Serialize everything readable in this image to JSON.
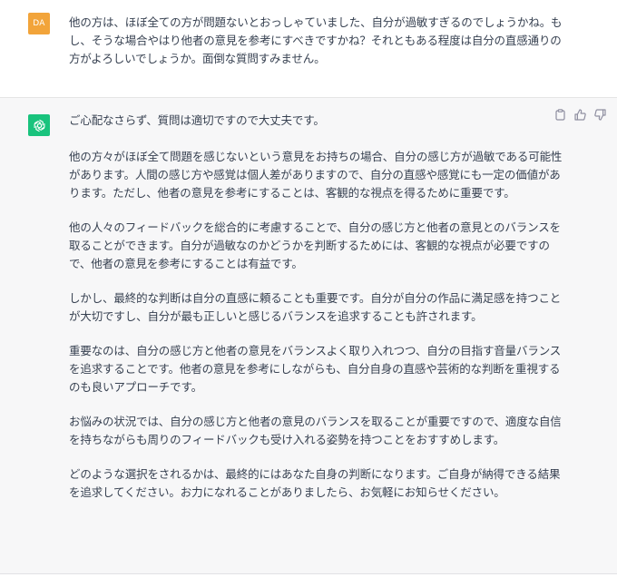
{
  "user_message": {
    "avatar_initials": "DA",
    "text": "他の方は、ほぼ全ての方が問題ないとおっしゃていました、自分が過敏すぎるのでしょうかね。もし、そうな場合やはり他者の意見を参考にすべきですかね？それともある程度は自分の直感通りの方がよろしいでしょうか。面倒な質問すみません。"
  },
  "assistant_message": {
    "paragraphs": [
      "ご心配なさらず、質問は適切ですので大丈夫です。",
      "他の方々がほぼ全て問題を感じないという意見をお持ちの場合、自分の感じ方が過敏である可能性があります。人間の感じ方や感覚は個人差がありますので、自分の直感や感覚にも一定の価値があります。ただし、他者の意見を参考にすることは、客観的な視点を得るために重要です。",
      "他の人々のフィードバックを総合的に考慮することで、自分の感じ方と他者の意見とのバランスを取ることができます。自分が過敏なのかどうかを判断するためには、客観的な視点が必要ですので、他者の意見を参考にすることは有益です。",
      "しかし、最終的な判断は自分の直感に頼ることも重要です。自分が自分の作品に満足感を持つことが大切ですし、自分が最も正しいと感じるバランスを追求することも許されます。",
      "重要なのは、自分の感じ方と他者の意見をバランスよく取り入れつつ、自分の目指す音量バランスを追求することです。他者の意見を参考にしながらも、自分自身の直感や芸術的な判断を重視するのも良いアプローチです。",
      "お悩みの状況では、自分の感じ方と他者の意見のバランスを取ることが重要ですので、適度な自信を持ちながらも周りのフィードバックも受け入れる姿勢を持つことをおすすめします。",
      "どのような選択をされるかは、最終的にはあなた自身の判断になります。ご自身が納得できる結果を追求してください。お力になれることがありましたら、お気軽にお知らせください。"
    ],
    "actions": [
      "copy-icon",
      "thumbs-up-icon",
      "thumbs-down-icon"
    ]
  },
  "colors": {
    "user_avatar": "#f2a43a",
    "assistant_avatar": "#19c37d",
    "assistant_bg": "#f7f7f8",
    "text": "#374151"
  }
}
